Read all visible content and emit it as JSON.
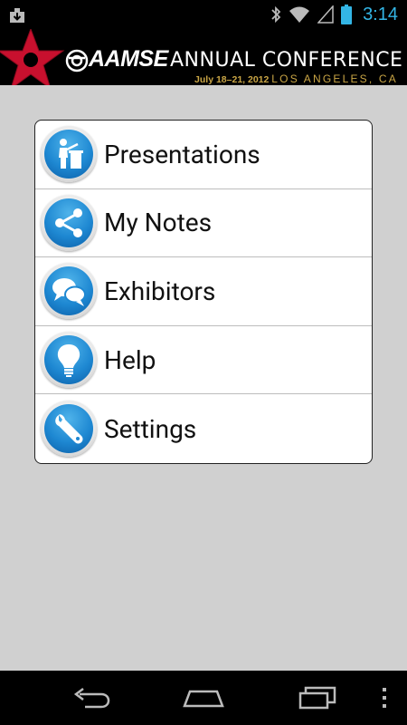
{
  "status_bar": {
    "time": "3:14",
    "icons": [
      "download-icon",
      "bluetooth-icon",
      "wifi-icon",
      "cell-signal-icon",
      "battery-icon"
    ]
  },
  "banner": {
    "brand": "AAMSE",
    "title": "ANNUAL CONFERENCE",
    "dates": "July 18–21, 2012",
    "location": "LOS ANGELES, CA",
    "colors": {
      "star": "#c8102e",
      "gold": "#c9a545"
    }
  },
  "menu": {
    "items": [
      {
        "label": "Presentations",
        "icon": "presenter-icon"
      },
      {
        "label": "My Notes",
        "icon": "share-icon"
      },
      {
        "label": "Exhibitors",
        "icon": "chat-bubbles-icon"
      },
      {
        "label": "Help",
        "icon": "lightbulb-icon"
      },
      {
        "label": "Settings",
        "icon": "wrench-icon"
      }
    ]
  },
  "nav_bar": {
    "buttons": [
      "back-icon",
      "home-icon",
      "recent-apps-icon",
      "overflow-menu-icon"
    ]
  },
  "colors": {
    "accent_blue": "#1e88d2",
    "status_time": "#33b5e5",
    "background": "#d0d0d0"
  }
}
